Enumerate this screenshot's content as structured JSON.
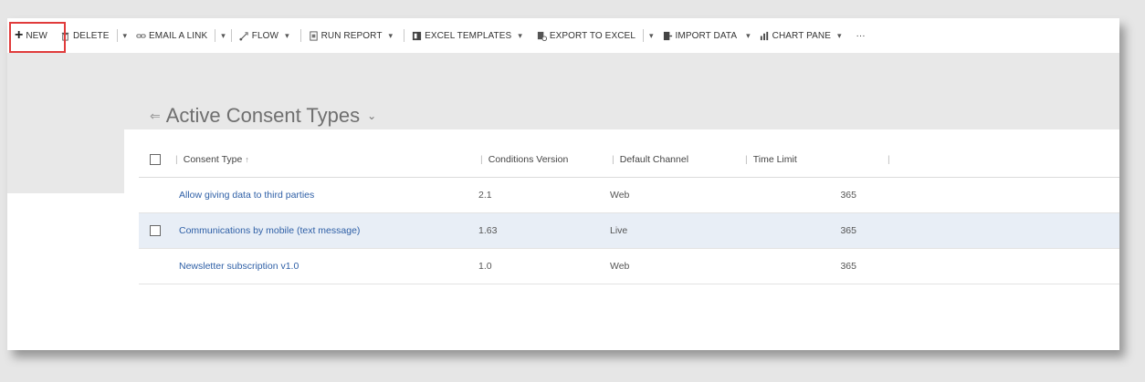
{
  "toolbar": {
    "new_label": "NEW",
    "delete_label": "DELETE",
    "email_link_label": "EMAIL A LINK",
    "flow_label": "FLOW",
    "run_report_label": "RUN REPORT",
    "excel_templates_label": "EXCEL TEMPLATES",
    "export_excel_label": "EXPORT TO EXCEL",
    "import_data_label": "IMPORT DATA",
    "chart_pane_label": "CHART PANE",
    "caret": "▾",
    "more": "···"
  },
  "view": {
    "title": "Active Consent Types",
    "pin_icon": "pin-icon",
    "chevron": "⌄"
  },
  "grid": {
    "columns": {
      "name": "Consent Type",
      "version": "Conditions Version",
      "channel": "Default Channel",
      "time_limit": "Time Limit"
    },
    "rows": [
      {
        "name": "Allow giving data to third parties",
        "version": "2.1",
        "channel": "Web",
        "time_limit": "365"
      },
      {
        "name": "Communications by mobile (text message)",
        "version": "1.63",
        "channel": "Live",
        "time_limit": "365"
      },
      {
        "name": "Newsletter subscription v1.0",
        "version": "1.0",
        "channel": "Web",
        "time_limit": "365"
      }
    ]
  },
  "colors": {
    "highlight_border": "#e03b3b",
    "link": "#2e5fa6",
    "selected_row": "#e8eef6"
  }
}
